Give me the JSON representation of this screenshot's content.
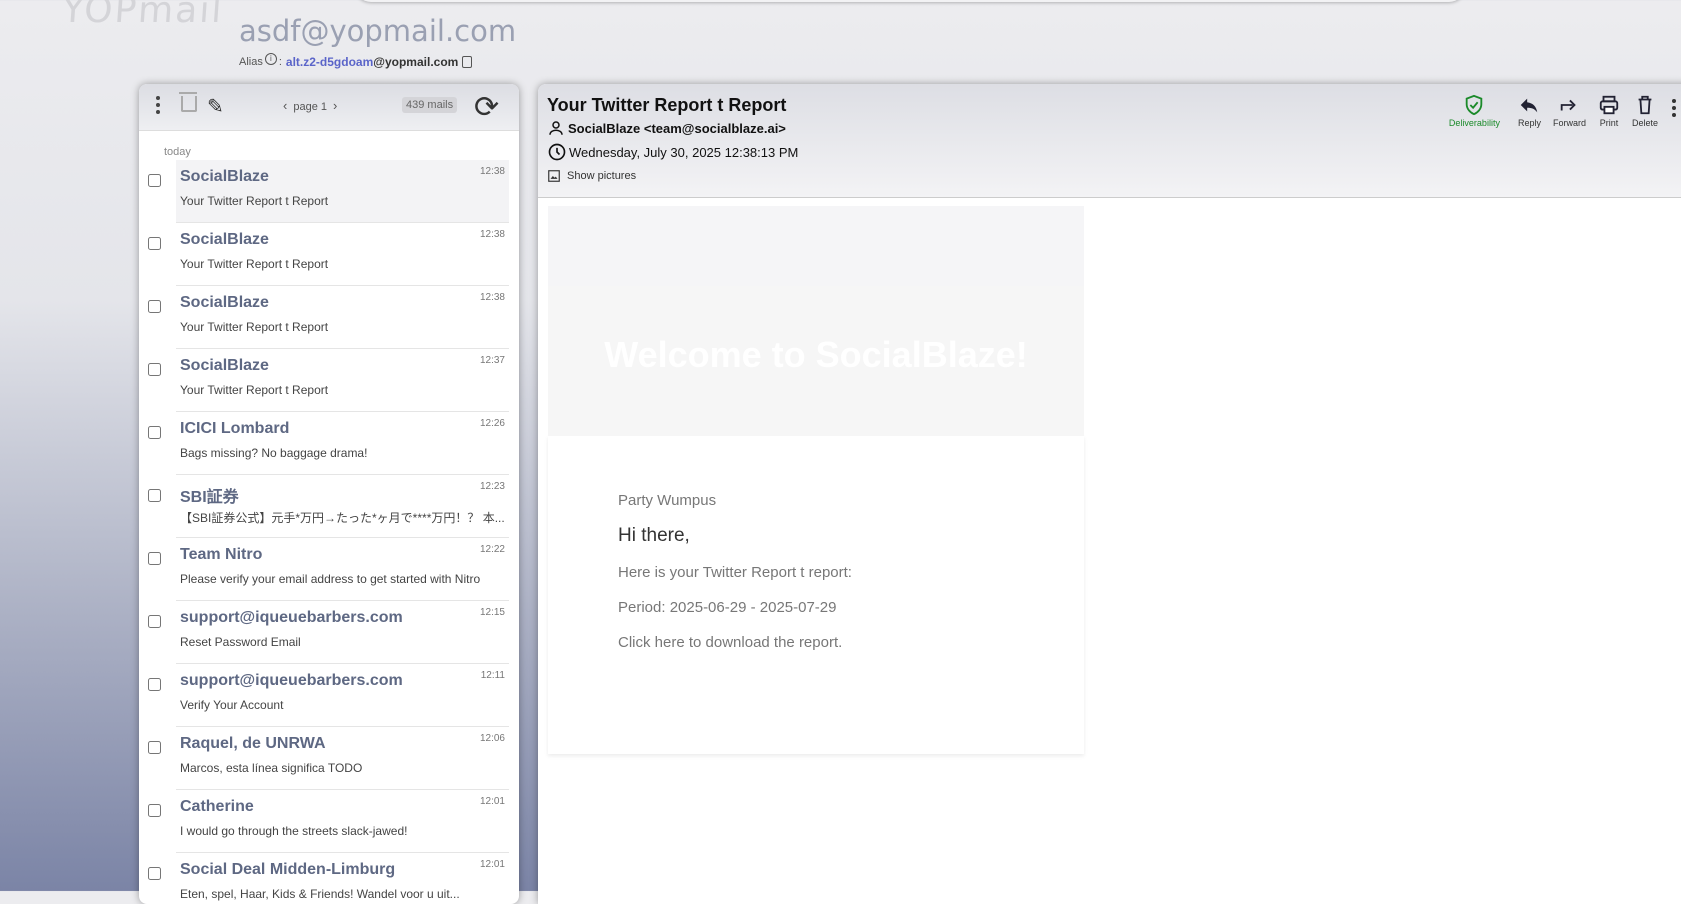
{
  "logo_text": "YOPmail",
  "account": {
    "email": "asdf@yopmail.com",
    "alias_label": "Alias",
    "alias_sep": ":",
    "alias_name": "alt.z2-d5gdoam",
    "alias_domain": "@yopmail.com"
  },
  "list_toolbar": {
    "page_label": "page 1",
    "mail_count": "439 mails"
  },
  "list": {
    "day_label": "today",
    "mails": [
      {
        "from": "SocialBlaze",
        "subject": "Your Twitter Report t Report",
        "time": "12:38"
      },
      {
        "from": "SocialBlaze",
        "subject": "Your Twitter Report t Report",
        "time": "12:38"
      },
      {
        "from": "SocialBlaze",
        "subject": "Your Twitter Report t Report",
        "time": "12:38"
      },
      {
        "from": "SocialBlaze",
        "subject": "Your Twitter Report t Report",
        "time": "12:37"
      },
      {
        "from": "ICICI Lombard",
        "subject": "Bags missing? No baggage drama!",
        "time": "12:26"
      },
      {
        "from": "SBI証券",
        "subject": "【SBI証券公式】元手*万円→たった*ヶ月で****万円！？ 本...",
        "time": "12:23"
      },
      {
        "from": "Team Nitro",
        "subject": "Please verify your email address to get started with Nitro",
        "time": "12:22"
      },
      {
        "from": "support@iqueuebarbers.com",
        "subject": "Reset Password Email",
        "time": "12:15"
      },
      {
        "from": "support@iqueuebarbers.com",
        "subject": "Verify Your Account",
        "time": "12:11"
      },
      {
        "from": "Raquel, de UNRWA",
        "subject": "Marcos, esta línea significa TODO",
        "time": "12:06"
      },
      {
        "from": "Catherine",
        "subject": "I would go through the streets slack-jawed!",
        "time": "12:01"
      },
      {
        "from": "Social Deal Midden-Limburg",
        "subject": "Eten, spel, Haar, Kids & Friends! Wandel voor u uit...",
        "time": "12:01"
      }
    ]
  },
  "reader": {
    "subject": "Your Twitter Report t Report",
    "sender": "SocialBlaze <team@socialblaze.ai>",
    "date": "Wednesday, July 30, 2025 12:38:13 PM",
    "show_pictures": "Show pictures",
    "actions": {
      "deliverability": "Deliverability",
      "reply": "Reply",
      "forward": "Forward",
      "print": "Print",
      "delete": "Delete"
    },
    "colors": {
      "deliverability": "#1b8a2a"
    }
  },
  "email": {
    "banner_title": "Welcome to SocialBlaze!",
    "brand": "Party Wumpus",
    "greeting": "Hi there,",
    "intro": "Here is your Twitter Report t report:",
    "period": "Period: 2025-06-29 - 2025-07-29",
    "cta": "Click here to download the report."
  }
}
